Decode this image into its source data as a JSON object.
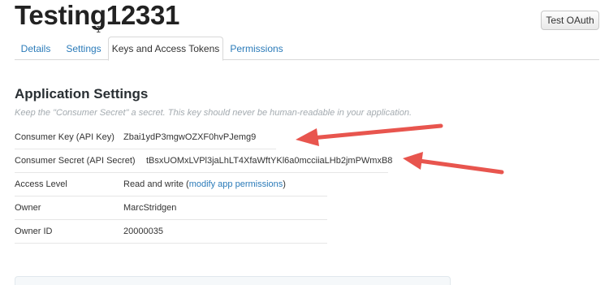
{
  "app": {
    "title": "Testing12331",
    "cursor_glyph": "I",
    "test_oauth_label": "Test OAuth"
  },
  "tabs": [
    {
      "label": "Details",
      "active": false
    },
    {
      "label": "Settings",
      "active": false
    },
    {
      "label": "Keys and Access Tokens",
      "active": true
    },
    {
      "label": "Permissions",
      "active": false
    }
  ],
  "settings": {
    "title": "Application Settings",
    "note": "Keep the \"Consumer Secret\" a secret. This key should never be human-readable in your application.",
    "rows": [
      {
        "label": "Consumer Key (API Key)",
        "value": "Zbai1ydP3mgwOZXF0hvPJemg9"
      },
      {
        "label": "Consumer Secret (API Secret)",
        "value": "tBsxUOMxLVPl3jaLhLT4XfaWftYKl6a0mcciiaLHb2jmPWmxB8"
      },
      {
        "label": "Access Level",
        "value_prefix": "Read and write (",
        "link": "modify app permissions",
        "value_suffix": ")"
      },
      {
        "label": "Owner",
        "value": "MarcStridgen"
      },
      {
        "label": "Owner ID",
        "value": "20000035"
      }
    ]
  },
  "annotations": {
    "arrow_color": "#e8554e",
    "arrow_count": 2
  }
}
